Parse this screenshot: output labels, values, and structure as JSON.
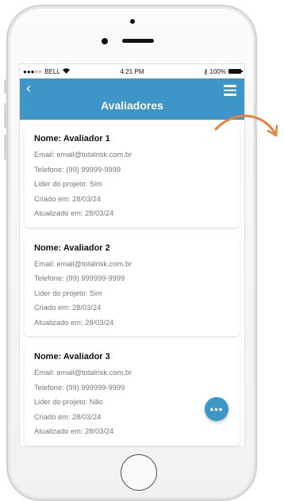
{
  "statusbar": {
    "carrier": "BELL",
    "time": "4:21 PM",
    "battery": "100%"
  },
  "appbar": {
    "back_icon": "chevron-left-icon",
    "menu_icon": "hamburger-menu-icon",
    "title": "Avaliadores"
  },
  "cards": [
    {
      "name": "Nome: Avaliador 1",
      "email": "Email: email@totalrisk.com.br",
      "phone": "Telefone: (99) 99999-9999",
      "leader": "Lider do projeto: Sim",
      "created": "Criado em: 28/03/24",
      "updated": "Atualizado em: 28/03/24"
    },
    {
      "name": "Nome: Avaliador 2",
      "email": "Email: email@totalrisk.com.br",
      "phone": "Telefone: (99) 999999-9999",
      "leader": "Lider do projeto: Sim",
      "created": "Criado em: 28/03/24",
      "updated": "Atualizado em: 28/03/24"
    },
    {
      "name": "Nome: Avaliador 3",
      "email": "Email: email@totalrisk.com.br",
      "phone": "Telefone: (99) 999999-9999",
      "leader": "Lider do projeto: Não",
      "created": "Criado em: 28/03/24",
      "updated": "Atualizado em: 28/03/24"
    }
  ],
  "fab": {
    "label": "•••",
    "icon": "more-options-icon"
  },
  "colors": {
    "primary": "#3d95c8",
    "annotation_arrow": "#e8823a"
  }
}
